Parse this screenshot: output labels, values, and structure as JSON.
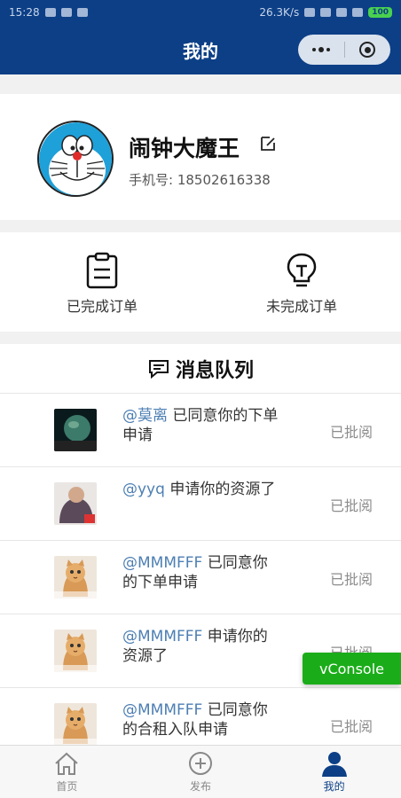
{
  "status_bar": {
    "time": "15:28",
    "network_speed": "26.3K/s",
    "battery": "100"
  },
  "navbar": {
    "title": "我的"
  },
  "profile": {
    "username": "闹钟大魔王",
    "phone": "手机号: 18502616338"
  },
  "orders": {
    "completed_label": "已完成订单",
    "pending_label": "未完成订单"
  },
  "messages": {
    "title": "消息队列",
    "items": [
      {
        "user": "@莫离",
        "text": " 已同意你的下单申请",
        "status": "已批阅",
        "thumb": "planet"
      },
      {
        "user": "@yyq",
        "text": " 申请你的资源了",
        "status": "已批阅",
        "thumb": "person"
      },
      {
        "user": "@MMMFFF",
        "text": " 已同意你的下单申请",
        "status": "已批阅",
        "thumb": "cat"
      },
      {
        "user": "@MMMFFF",
        "text": " 申请你的资源了",
        "status": "已批阅",
        "thumb": "cat"
      },
      {
        "user": "@MMMFFF",
        "text": " 已同意你的合租入队申请",
        "status": "已批阅",
        "thumb": "cat"
      }
    ]
  },
  "vconsole": {
    "label": "vConsole"
  },
  "tabbar": {
    "items": [
      {
        "label": "首页",
        "icon": "home-icon"
      },
      {
        "label": "发布",
        "icon": "plus-circle-icon"
      },
      {
        "label": "我的",
        "icon": "user-icon"
      }
    ],
    "active_color": "#0c3f86"
  },
  "colors": {
    "header_bg": "#0c3f86",
    "user_link": "#4d7fb3",
    "vconsole_bg": "#1aad19"
  }
}
